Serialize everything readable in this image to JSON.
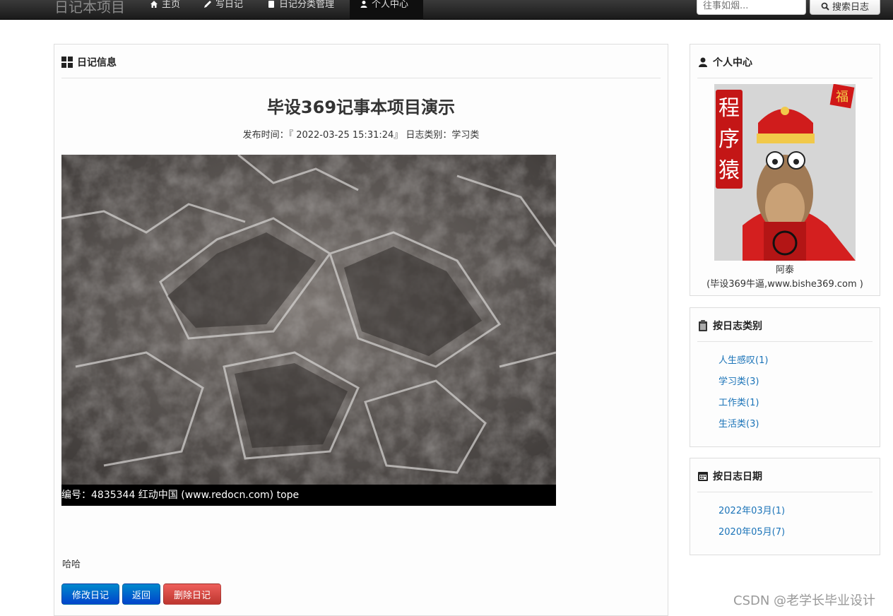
{
  "nav": {
    "brand": "日记本项目",
    "items": [
      {
        "label": "主页",
        "icon": "home-icon"
      },
      {
        "label": "写日记",
        "icon": "pencil-icon"
      },
      {
        "label": "日记分类管理",
        "icon": "book-icon"
      },
      {
        "label": "个人中心",
        "icon": "user-icon"
      }
    ],
    "search_placeholder": "往事如烟...",
    "search_button": "搜索日志"
  },
  "main": {
    "heading": "日记信息",
    "title": "毕设369记事本项目演示",
    "meta": "发布时间：『 2022-03-25 15:31:24』  日志类别：学习类",
    "image_caption": "编号：4835344    红动中国 (www.redocn.com)    tope",
    "content": "哈哈",
    "buttons": {
      "edit": "修改日记",
      "back": "返回",
      "delete": "删除日记"
    }
  },
  "profile": {
    "heading": "个人中心",
    "avatar_text": [
      "程",
      "序",
      "猿",
      "福"
    ],
    "name": "阿泰",
    "sign": "(毕设369牛逼,www.bishe369.com )"
  },
  "by_type": {
    "heading": "按日志类别",
    "items": [
      "人生感叹(1)",
      "学习类(3)",
      "工作类(1)",
      "生活类(3)"
    ]
  },
  "by_date": {
    "heading": "按日志日期",
    "items": [
      "2022年03月(1)",
      "2020年05月(7)"
    ]
  },
  "watermark": "CSDN @老学长毕业设计",
  "colors": {
    "link": "#1a73b8",
    "primary": "#0055cc",
    "danger": "#d9534f",
    "navbar": "#222222"
  }
}
